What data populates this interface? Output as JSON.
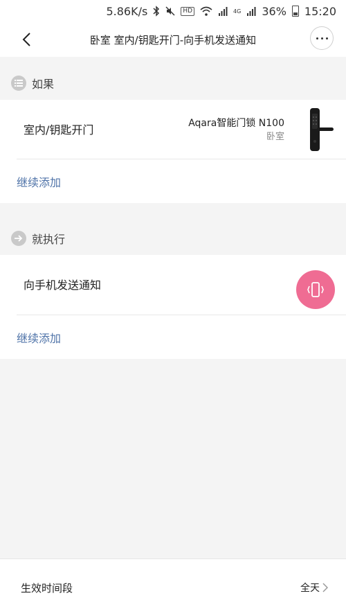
{
  "status_bar": {
    "speed": "5.86K/s",
    "hd": "HD",
    "signal_label": "4G",
    "battery": "36%",
    "time": "15:20"
  },
  "nav": {
    "title": "卧室 室内/钥匙开门-向手机发送通知",
    "back_icon": "chevron-left-icon",
    "more_icon": "more-dots-icon"
  },
  "if_section": {
    "header": "如果",
    "icon": "list-icon",
    "trigger": {
      "title": "室内/钥匙开门",
      "device_name": "Aqara智能门锁 N100",
      "room": "卧室"
    },
    "add_label": "继续添加"
  },
  "then_section": {
    "header": "就执行",
    "icon": "arrow-right-icon",
    "action": {
      "title": "向手机发送通知",
      "icon_color": "#ef6c93"
    },
    "add_label": "继续添加"
  },
  "bottom": {
    "label": "生效时间段",
    "value": "全天"
  },
  "colors": {
    "link": "#4f73a8",
    "background": "#f4f4f4",
    "card": "#ffffff"
  }
}
